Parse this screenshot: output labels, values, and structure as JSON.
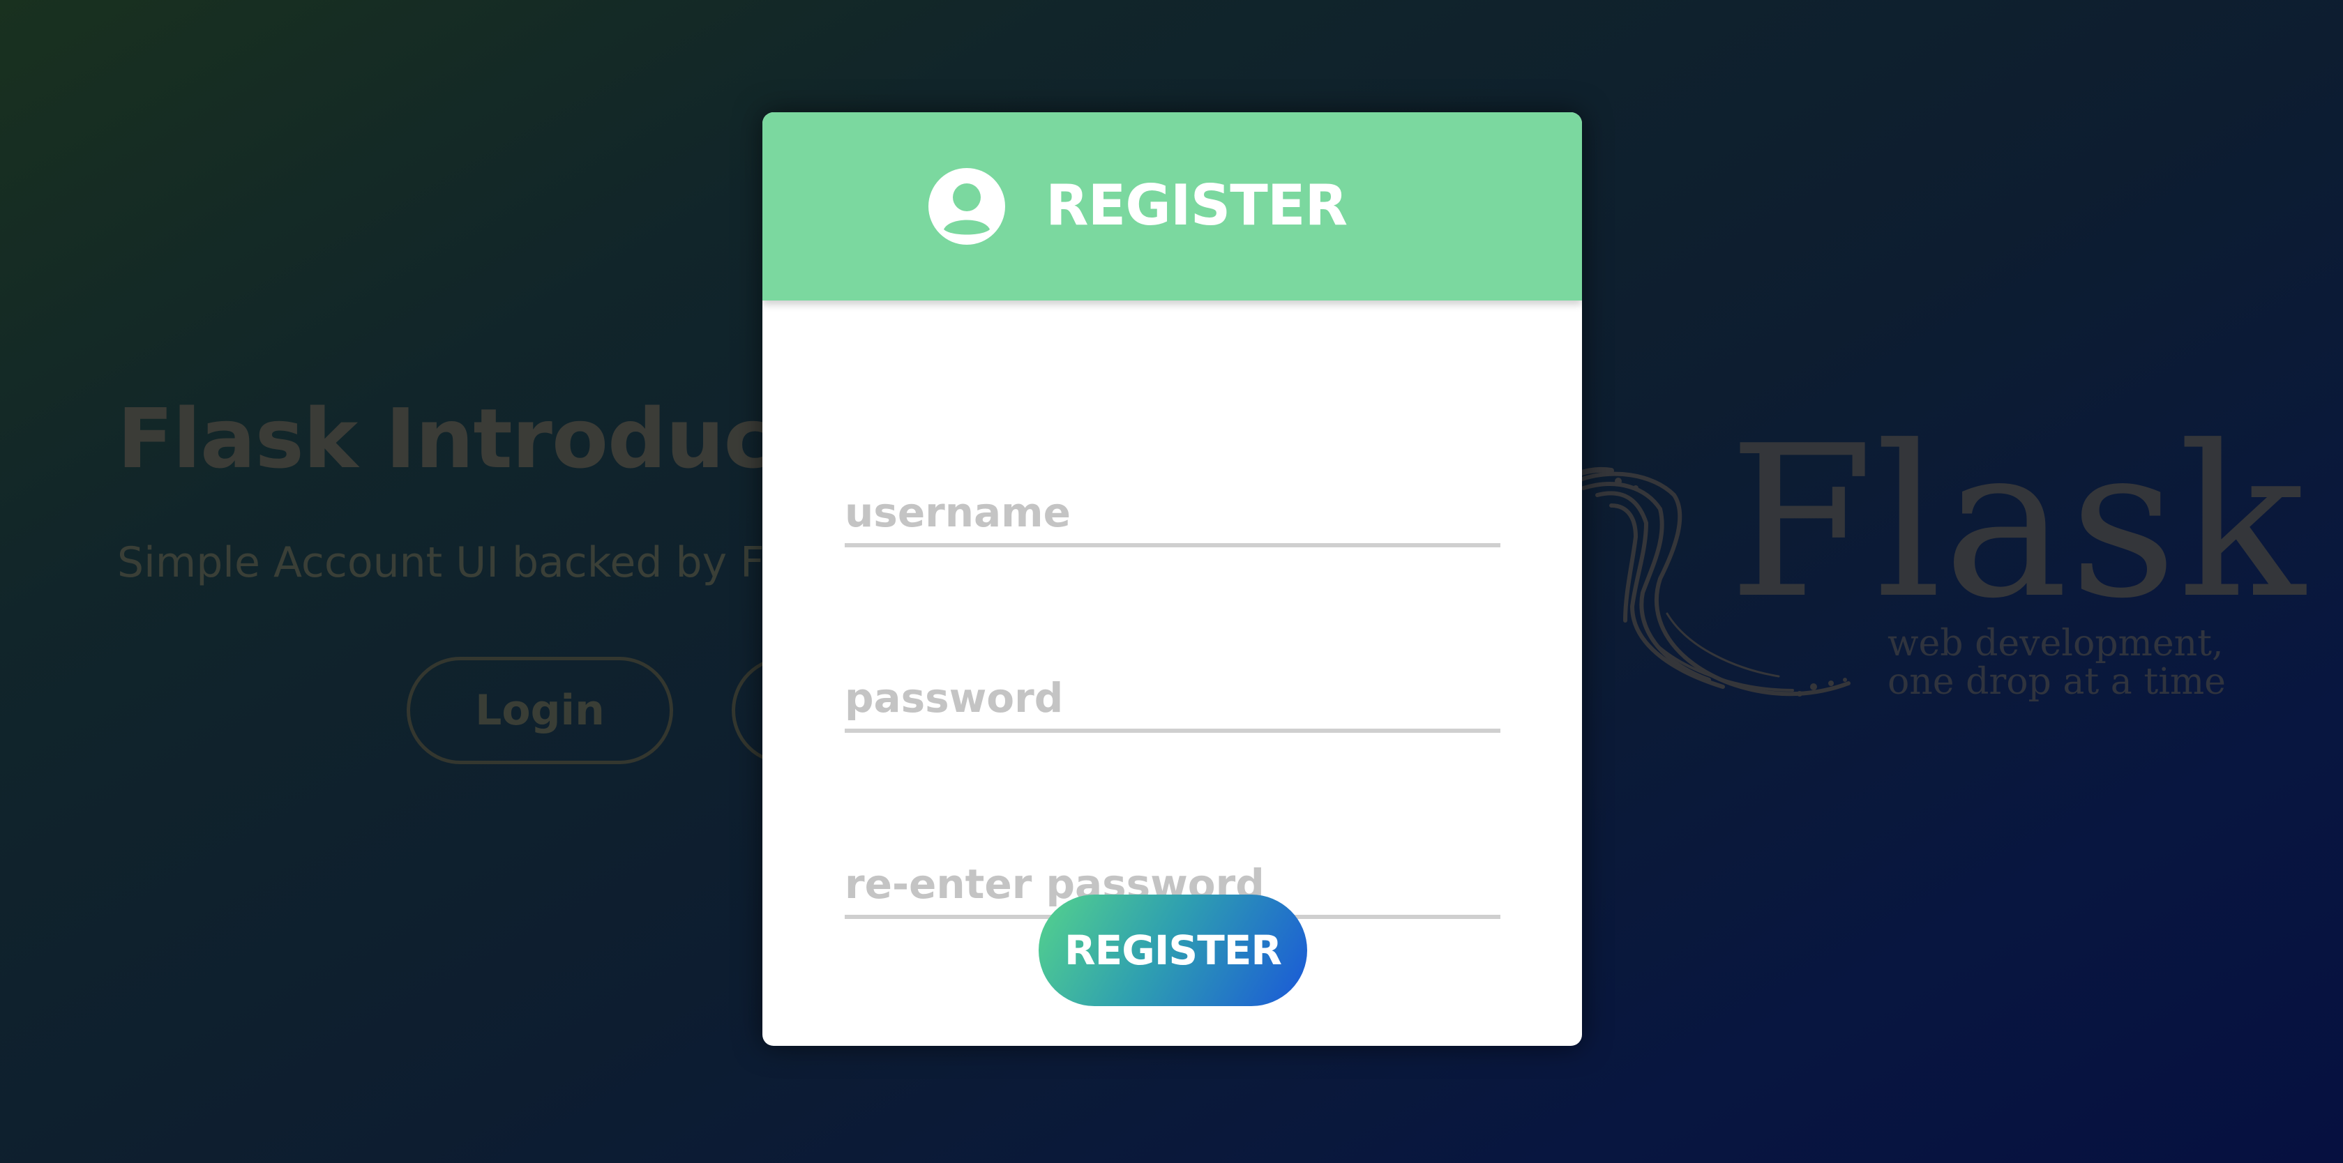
{
  "background": {
    "hero_title": "Flask Introductio",
    "hero_subtitle": "Simple Account UI backed by Fla",
    "login_button": "Login",
    "register_button": "",
    "logo_word": "Flask",
    "logo_tagline_1": "web development,",
    "logo_tagline_2": "one drop at a time"
  },
  "modal": {
    "title": "REGISTER",
    "header_icon": "user-circle-icon",
    "header_color": "#7bd89f",
    "fields": {
      "username_placeholder": "username",
      "password_placeholder": "password",
      "reenter_placeholder": "re-enter password"
    },
    "submit_label": "REGISTER",
    "submit_gradient": [
      "#55d28c",
      "#1a58d8"
    ]
  }
}
